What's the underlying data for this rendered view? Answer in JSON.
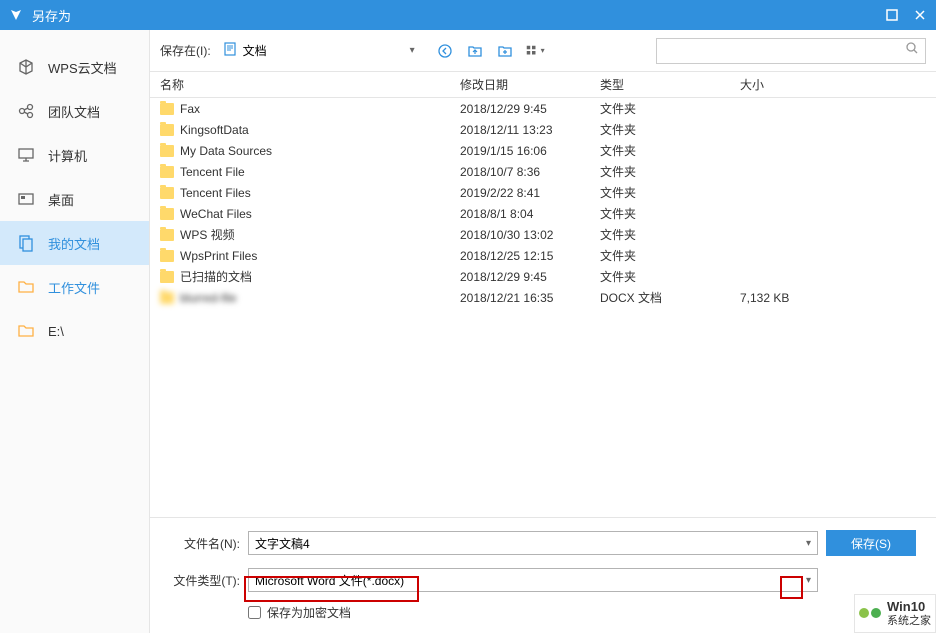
{
  "titlebar": {
    "title": "另存为"
  },
  "sidebar": {
    "items": [
      {
        "label": "WPS云文档",
        "icon": "cube"
      },
      {
        "label": "团队文档",
        "icon": "share"
      },
      {
        "label": "计算机",
        "icon": "monitor"
      },
      {
        "label": "桌面",
        "icon": "desktop"
      },
      {
        "label": "我的文档",
        "icon": "docs"
      },
      {
        "label": "工作文件",
        "icon": "folder"
      },
      {
        "label": "E:\\",
        "icon": "folder"
      }
    ]
  },
  "toolbar": {
    "save_in_label": "保存在(I):",
    "location": "文档"
  },
  "columns": {
    "name": "名称",
    "date": "修改日期",
    "type": "类型",
    "size": "大小"
  },
  "files": [
    {
      "name": "Fax",
      "date": "2018/12/29 9:45",
      "type": "文件夹",
      "size": ""
    },
    {
      "name": "KingsoftData",
      "date": "2018/12/11 13:23",
      "type": "文件夹",
      "size": ""
    },
    {
      "name": "My Data Sources",
      "date": "2019/1/15 16:06",
      "type": "文件夹",
      "size": ""
    },
    {
      "name": "Tencent File",
      "date": "2018/10/7 8:36",
      "type": "文件夹",
      "size": ""
    },
    {
      "name": "Tencent Files",
      "date": "2019/2/22 8:41",
      "type": "文件夹",
      "size": ""
    },
    {
      "name": "WeChat Files",
      "date": "2018/8/1 8:04",
      "type": "文件夹",
      "size": ""
    },
    {
      "name": "WPS 视频",
      "date": "2018/10/30 13:02",
      "type": "文件夹",
      "size": ""
    },
    {
      "name": "WpsPrint Files",
      "date": "2018/12/25 12:15",
      "type": "文件夹",
      "size": ""
    },
    {
      "name": "已扫描的文档",
      "date": "2018/12/29 9:45",
      "type": "文件夹",
      "size": ""
    },
    {
      "name": "blurred-file",
      "date": "2018/12/21 16:35",
      "type": "DOCX 文档",
      "size": "7,132 KB",
      "blurred": true
    }
  ],
  "form": {
    "filename_label": "文件名(N):",
    "filename_value": "文字文稿4",
    "filetype_label": "文件类型(T):",
    "filetype_value": "Microsoft Word 文件(*.docx)",
    "save_button": "保存(S)",
    "encrypt_label": "保存为加密文档"
  },
  "watermark": {
    "brand": "Win10",
    "subtitle": "系统之家"
  }
}
